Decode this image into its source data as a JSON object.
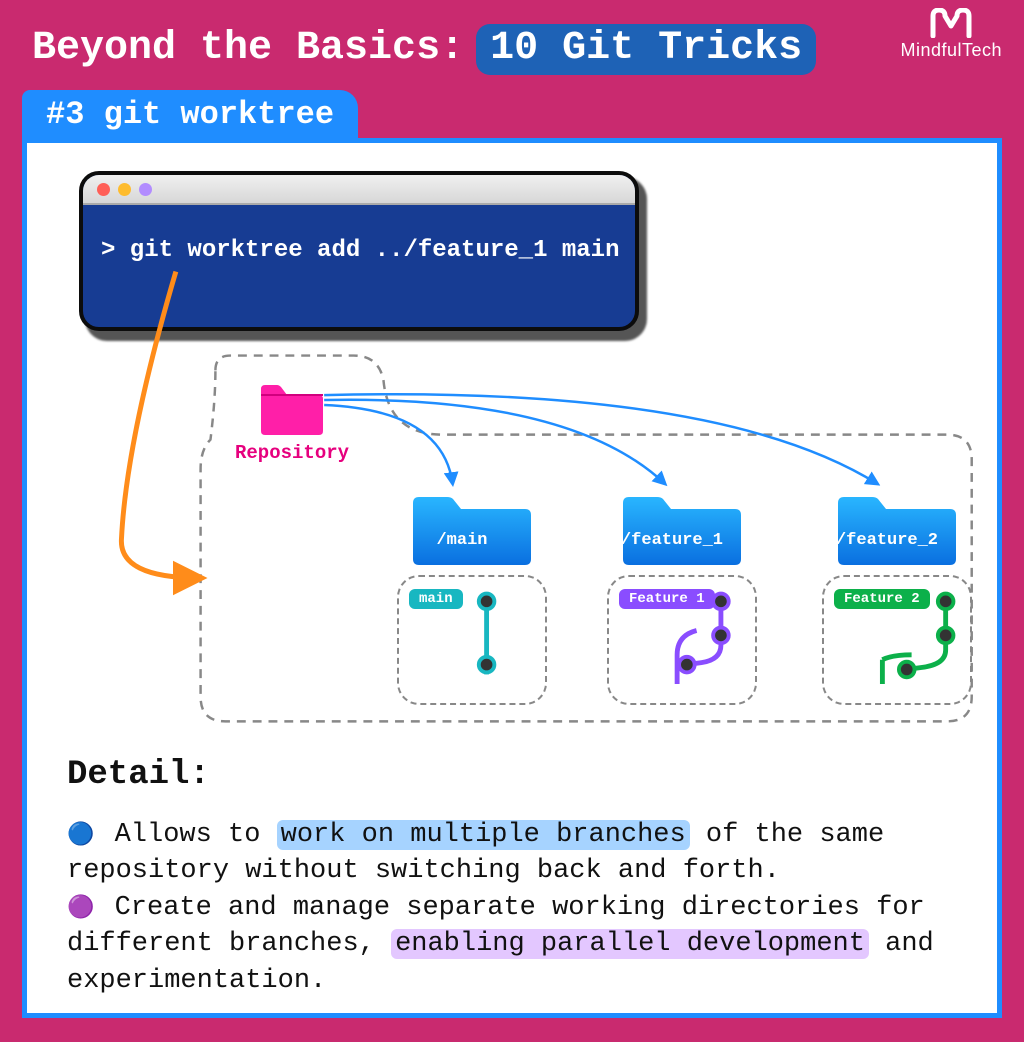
{
  "brand": "MindfulTech",
  "title": {
    "a": "Beyond the Basics:",
    "b": "10 Git Tricks"
  },
  "tab": "#3 git worktree",
  "terminal": {
    "command": "> git worktree add ../feature_1 main"
  },
  "repo": {
    "label": "Repository"
  },
  "worktrees": [
    {
      "path": "/main",
      "branch": "main",
      "color": "#18b7c1"
    },
    {
      "path": "/feature_1",
      "branch": "Feature 1",
      "color": "#8a4dff"
    },
    {
      "path": "/feature_2",
      "branch": "Feature 2",
      "color": "#0cb04a"
    }
  ],
  "detail": {
    "heading": "Detail:",
    "line1": {
      "pre": " Allows to ",
      "hl": "work on multiple branches",
      "post": " of the same repository without switching back and forth."
    },
    "line2": {
      "pre": " Create and manage separate working directories for different branches, ",
      "hl": "enabling parallel development",
      "post": " and experimentation."
    }
  },
  "colors": {
    "bg": "#c92a6f",
    "accent": "#1f8dff",
    "terminal": "#173c93",
    "orange": "#ff8c1a",
    "magenta": "#e6007e"
  }
}
